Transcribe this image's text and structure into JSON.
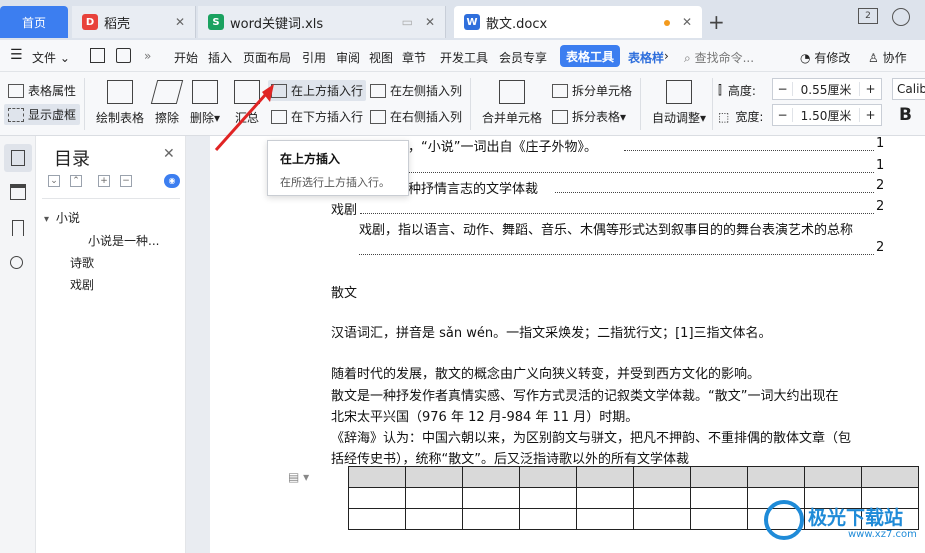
{
  "tabs": {
    "home": "首页",
    "daoke": "稻壳",
    "xls": "word关键词.xls",
    "docx": "散文.docx"
  },
  "menu": {
    "file": "文件",
    "items": [
      "开始",
      "插入",
      "页面布局",
      "引用",
      "审阅",
      "视图",
      "章节",
      "开发工具",
      "会员专享"
    ],
    "table_tools": "表格工具",
    "table_style": "表格样",
    "search": "查找命令...",
    "modify": "有修改",
    "collab": "协作"
  },
  "ribbon": {
    "table_props": "表格属性",
    "show_grid": "显示虚框",
    "draw_table": "绘制表格",
    "erase": "擦除",
    "delete": "删除",
    "summary": "汇总",
    "insert_above": "在上方插入行",
    "insert_below": "在下方插入行",
    "insert_left": "在左侧插入列",
    "insert_right": "在右侧插入列",
    "merge_cells": "合并单元格",
    "split_cells": "拆分单元格",
    "split_table": "拆分表格",
    "auto_fit": "自动调整",
    "height_label": "高度:",
    "height_value": "0.55厘米",
    "width_label": "宽度:",
    "width_value": "1.50厘米",
    "font": "Calib",
    "bold": "B"
  },
  "tooltip": {
    "title": "在上方插入",
    "desc": "在所选行上方插入行。"
  },
  "toc": {
    "title": "目录",
    "items": [
      {
        "label": "小说"
      },
      {
        "label": "小说是一种..."
      },
      {
        "label": "诗歌"
      },
      {
        "label": "戏剧"
      }
    ]
  },
  "document": {
    "toc_line1": "，“小说”一词出自《庄子外物》。",
    "toc_line2": "种抒情言志的文学体裁",
    "toc_line3": "戏剧",
    "toc_line4": "戏剧，指以语言、动作、舞蹈、音乐、木偶等形式达到叙事目的的舞台表演艺术的总称",
    "page_num": "2",
    "page_num_1": "1",
    "heading": "散文",
    "para1": "汉语词汇，拼音是 sǎn wén。一指文采焕发；二指犹行文；[1]三指文体名。",
    "para2": "随着时代的发展，散文的概念由广义向狭义转变，并受到西方文化的影响。",
    "para3a": "散文是一种抒发作者真情实感、写作方式灵活的记叙类文学体裁。“散文”一词大约出现在",
    "para3b": "北宋太平兴国（976 年 12 月-984 年 11 月）时期。",
    "para4a": "《辞海》认为：中国六朝以来，为区别韵文与骈文，把凡不押韵、不重排偶的散体文章（包",
    "para4b": "括经传史书），统称“散文”。后又泛指诗歌以外的所有文学体裁"
  },
  "watermark": {
    "text": "极光下载站",
    "url": "www.xz7.com"
  }
}
